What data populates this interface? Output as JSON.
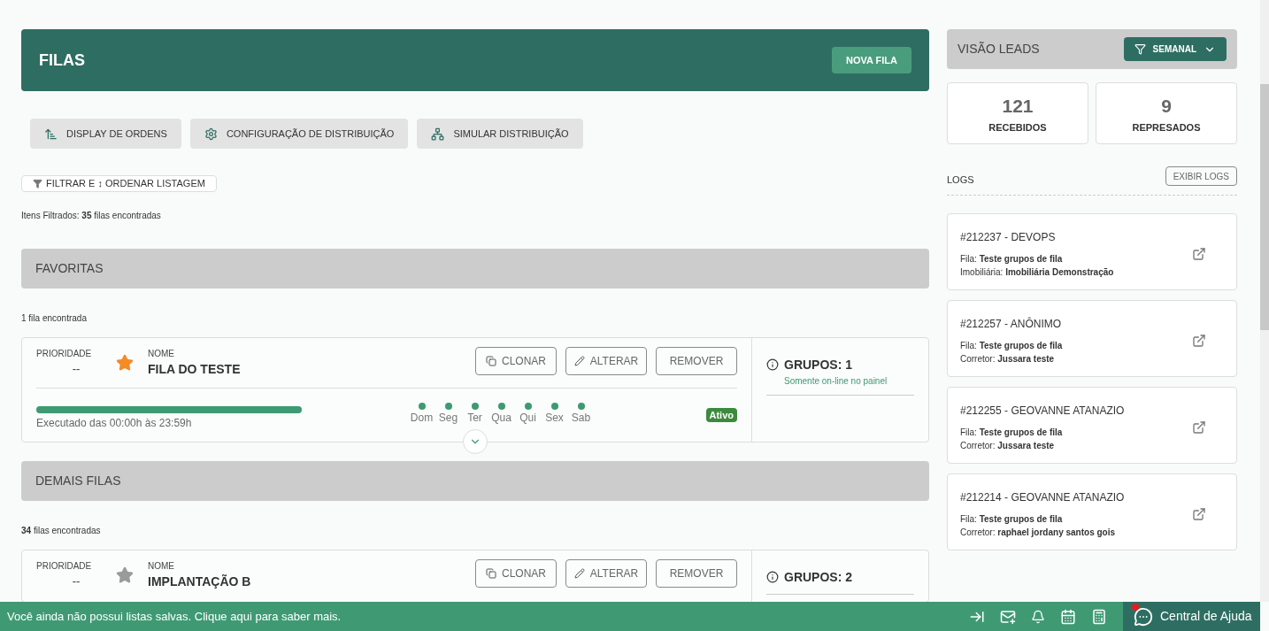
{
  "header": {
    "title": "FILAS",
    "new_button": "NOVA FILA"
  },
  "toolbar": [
    "DISPLAY DE ORDENS",
    "CONFIGURAÇÃO DE DISTRIBUIÇÃO",
    "SIMULAR DISTRIBUIÇÃO"
  ],
  "filter_button": "FILTRAR E ↕ ORDENAR LISTAGEM",
  "filtered_info": "Itens Filtrados: **35** filas encontradas",
  "sections": [
    {
      "title": "FAVORITAS",
      "count": "1 fila encontrada",
      "queues": [
        {
          "priority_label": "PRIORIDADE",
          "priority": "--",
          "favorite": true,
          "name_label": "NOME",
          "name": "FILA DO TESTE",
          "actions": [
            "CLONAR",
            "ALTERAR",
            "REMOVER"
          ],
          "level": 1,
          "schedule": "Executado das 00:00h às 23:59h",
          "days": [
            {
              "label": "Dom",
              "on": true
            },
            {
              "label": "Seg",
              "on": true
            },
            {
              "label": "Ter",
              "on": true
            },
            {
              "label": "Qua",
              "on": true
            },
            {
              "label": "Qui",
              "on": true
            },
            {
              "label": "Sex",
              "on": true
            },
            {
              "label": "Sab",
              "on": true
            }
          ],
          "status": "Ativo",
          "groups": "GRUPOS: 1",
          "groups_note": "Somente on-line no painel"
        }
      ]
    },
    {
      "title": "DEMAIS FILAS",
      "count": "**34** filas encontradas",
      "queues": [
        {
          "priority_label": "PRIORIDADE",
          "priority": "--",
          "favorite": false,
          "name_label": "NOME",
          "name": "IMPLANTAÇÃO B",
          "actions": [
            "CLONAR",
            "ALTERAR",
            "REMOVER"
          ],
          "groups": "GRUPOS: 2"
        }
      ]
    }
  ],
  "leads": {
    "title": "VISÃO LEADS",
    "period": "SEMANAL",
    "stats": [
      {
        "value": "121",
        "label": "RECEBIDOS"
      },
      {
        "value": "9",
        "label": "REPRESADOS"
      }
    ]
  },
  "logs": {
    "title": "LOGS",
    "button": "EXIBIR LOGS",
    "items": [
      {
        "title": "#212237 - DEVOPS",
        "lines": [
          "Fila: **Teste grupos de fila**",
          "Imobiliária: **Imobiliária Demonstração**"
        ]
      },
      {
        "title": "#212257 - ANÔNIMO",
        "lines": [
          "Fila: **Teste grupos de fila**",
          "Corretor: **Jussara teste**"
        ]
      },
      {
        "title": "#212255 - GEOVANNE ATANAZIO",
        "lines": [
          "Fila: **Teste grupos de fila**",
          "Corretor: **Jussara teste**"
        ]
      },
      {
        "title": "#212214 - GEOVANNE ATANAZIO",
        "lines": [
          "Fila: **Teste grupos de fila**",
          "Corretor: **raphael jordany santos gois**"
        ]
      }
    ]
  },
  "bottom_bar": {
    "message": "Você ainda não possui listas salvas. Clique aqui para saber mais.",
    "help": "Central de Ajuda",
    "help_notification": true
  }
}
